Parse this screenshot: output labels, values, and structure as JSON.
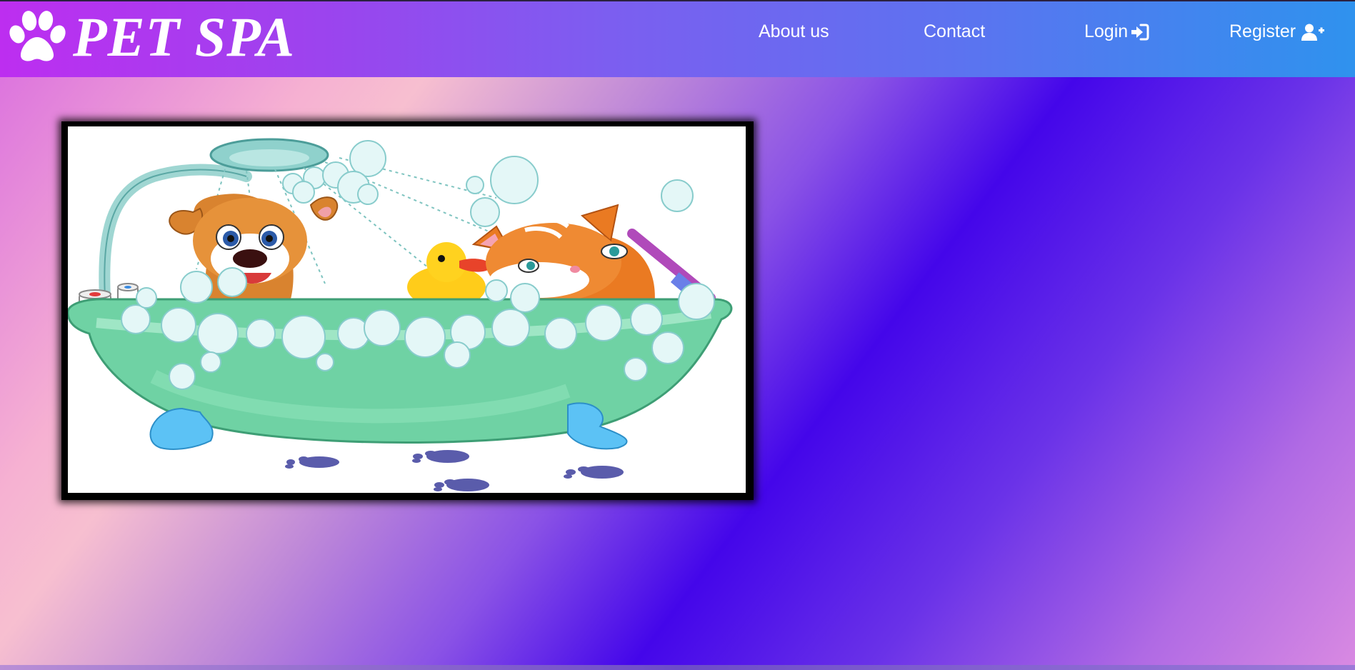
{
  "brand": {
    "name": "PET SPA",
    "icon": "paw-icon"
  },
  "nav": {
    "about": "About us",
    "contact": "Contact",
    "login": "Login",
    "login_icon": "sign-in-icon",
    "register": "Register",
    "register_icon": "user-plus-icon"
  },
  "hero_image": {
    "subject": "cartoon dog and cat bathing in a green bathtub with a rubber duck"
  },
  "colors": {
    "nav_left": "#bd2ef0",
    "nav_right": "#2f92ee",
    "text": "#ffffff"
  }
}
